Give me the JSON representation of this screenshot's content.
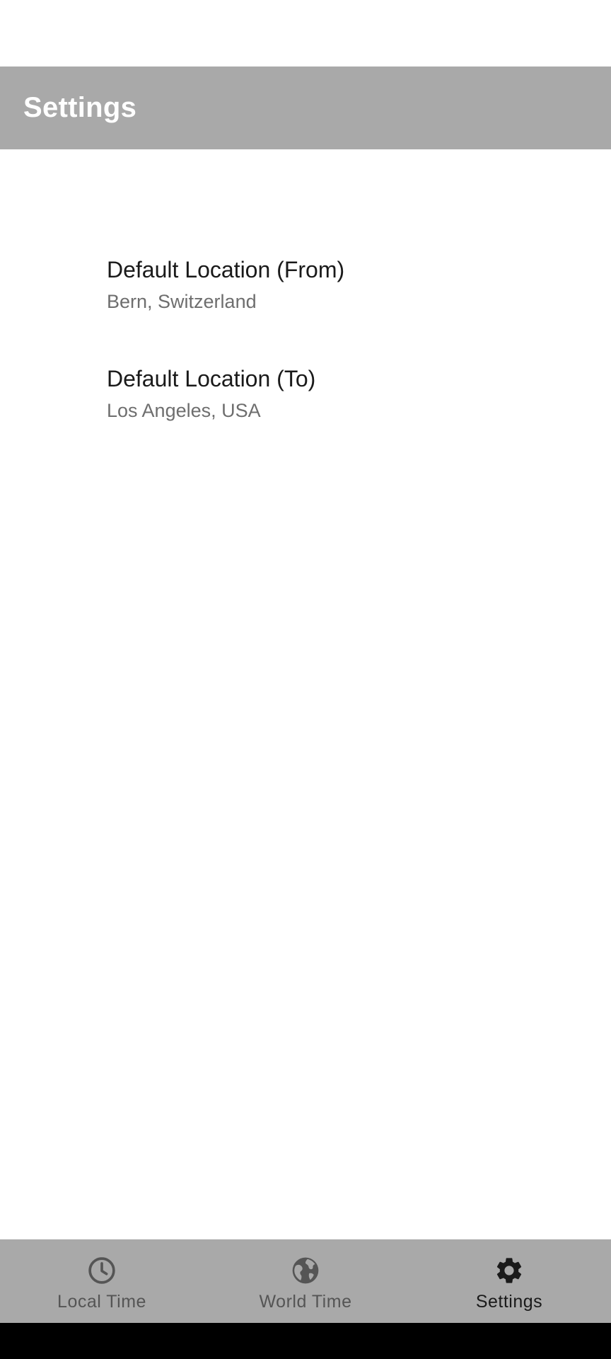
{
  "app_bar": {
    "title": "Settings"
  },
  "preferences": [
    {
      "title": "Default Location (From)",
      "summary": "Bern, Switzerland"
    },
    {
      "title": "Default Location (To)",
      "summary": "Los Angeles, USA"
    }
  ],
  "bottom_nav": {
    "items": [
      {
        "label": "Local Time",
        "icon": "clock-icon",
        "active": false
      },
      {
        "label": "World Time",
        "icon": "globe-icon",
        "active": false
      },
      {
        "label": "Settings",
        "icon": "gear-icon",
        "active": true
      }
    ]
  },
  "colors": {
    "app_bar_background": "#a9a9a9",
    "bottom_nav_background": "#a9a9a9",
    "inactive_nav_color": "#555555",
    "active_nav_color": "#1a1a1a"
  }
}
